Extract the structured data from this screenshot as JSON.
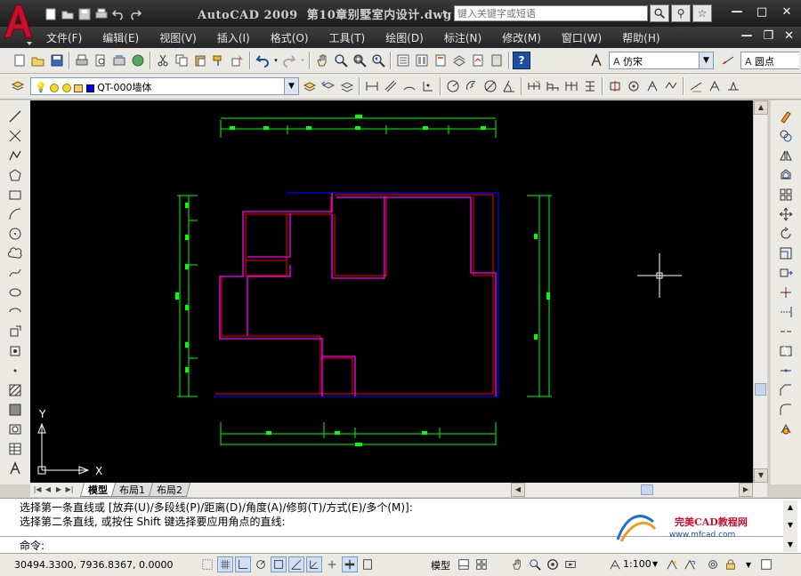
{
  "title": {
    "app": "AutoCAD 2009",
    "document": "第10章别墅室内设计.dwg",
    "search_placeholder": "键入关键字或短语"
  },
  "window_controls": {
    "minimize": "—",
    "restore": "□",
    "close": "✕"
  },
  "doc_controls": {
    "minimize": "—",
    "restore": "❐",
    "close": "✕"
  },
  "menu": [
    "文件(F)",
    "编辑(E)",
    "视图(V)",
    "插入(I)",
    "格式(O)",
    "工具(T)",
    "绘图(D)",
    "标注(N)",
    "修改(M)",
    "窗口(W)",
    "帮助(H)"
  ],
  "toolbar": {
    "text_style": "仿宋",
    "dim_style": "圆点",
    "layer": "QT-000墙体",
    "help_label": "?"
  },
  "tabs": [
    "模型",
    "布局1",
    "布局2"
  ],
  "active_tab": "模型",
  "command": {
    "history": [
      "选择第一条直线或 [放弃(U)/多段线(P)/距离(D)/角度(A)/修剪(T)/方式(E)/多个(M)]:",
      "选择第二条直线, 或按住 Shift 键选择要应用角点的直线:"
    ],
    "prompt": "命令:"
  },
  "watermark": {
    "brand": "完美CAD教程网",
    "url": "www.mfcad.com"
  },
  "status": {
    "coordinates": "30494.3300, 7936.8367, 0.0000",
    "model_label": "模型",
    "scale": "1:100"
  },
  "ucs": {
    "x_label": "X",
    "y_label": "Y"
  },
  "colors": {
    "canvas_bg": "#000000",
    "wall_magenta": "#ff00ff",
    "wall_red": "#ff0000",
    "outline_blue": "#0000ff",
    "dimension_green": "#00ff00",
    "crosshair": "#ffffff",
    "logo_red": "#c8102e"
  }
}
